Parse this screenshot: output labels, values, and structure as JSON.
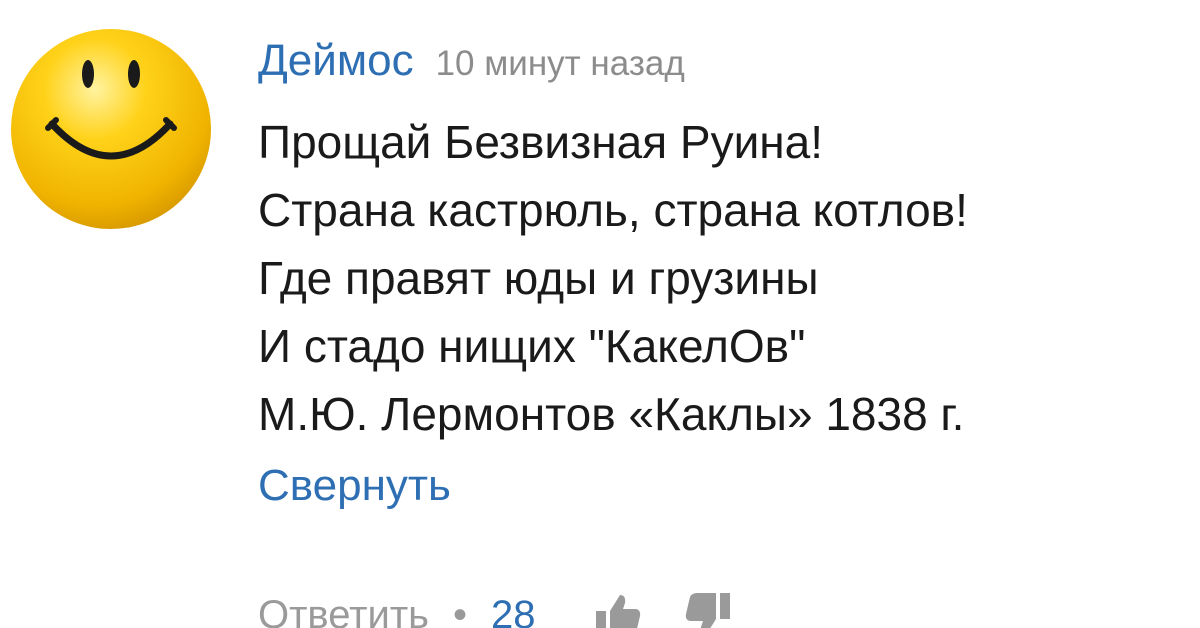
{
  "comment": {
    "author": "Деймос",
    "time": "10 минут назад",
    "lines": [
      "Прощай Безвизная Руина!",
      "Страна кастрюль, страна котлов!",
      "Где правят юды и грузины",
      "И стадо нищих \"КакелОв\"",
      "М.Ю. Лермонтов «Каклы» 1838 г."
    ],
    "collapse_label": "Свернуть",
    "reply_label": "Ответить",
    "separator": "•",
    "likes": "28",
    "avatar_icon": "smiley-face-icon",
    "like_icon": "thumbs-up-icon",
    "dislike_icon": "thumbs-down-icon"
  },
  "colors": {
    "link": "#2e6fb4",
    "muted": "#8c8c8c",
    "text": "#1a1a1a",
    "avatar_yellow": "#f5c400"
  }
}
